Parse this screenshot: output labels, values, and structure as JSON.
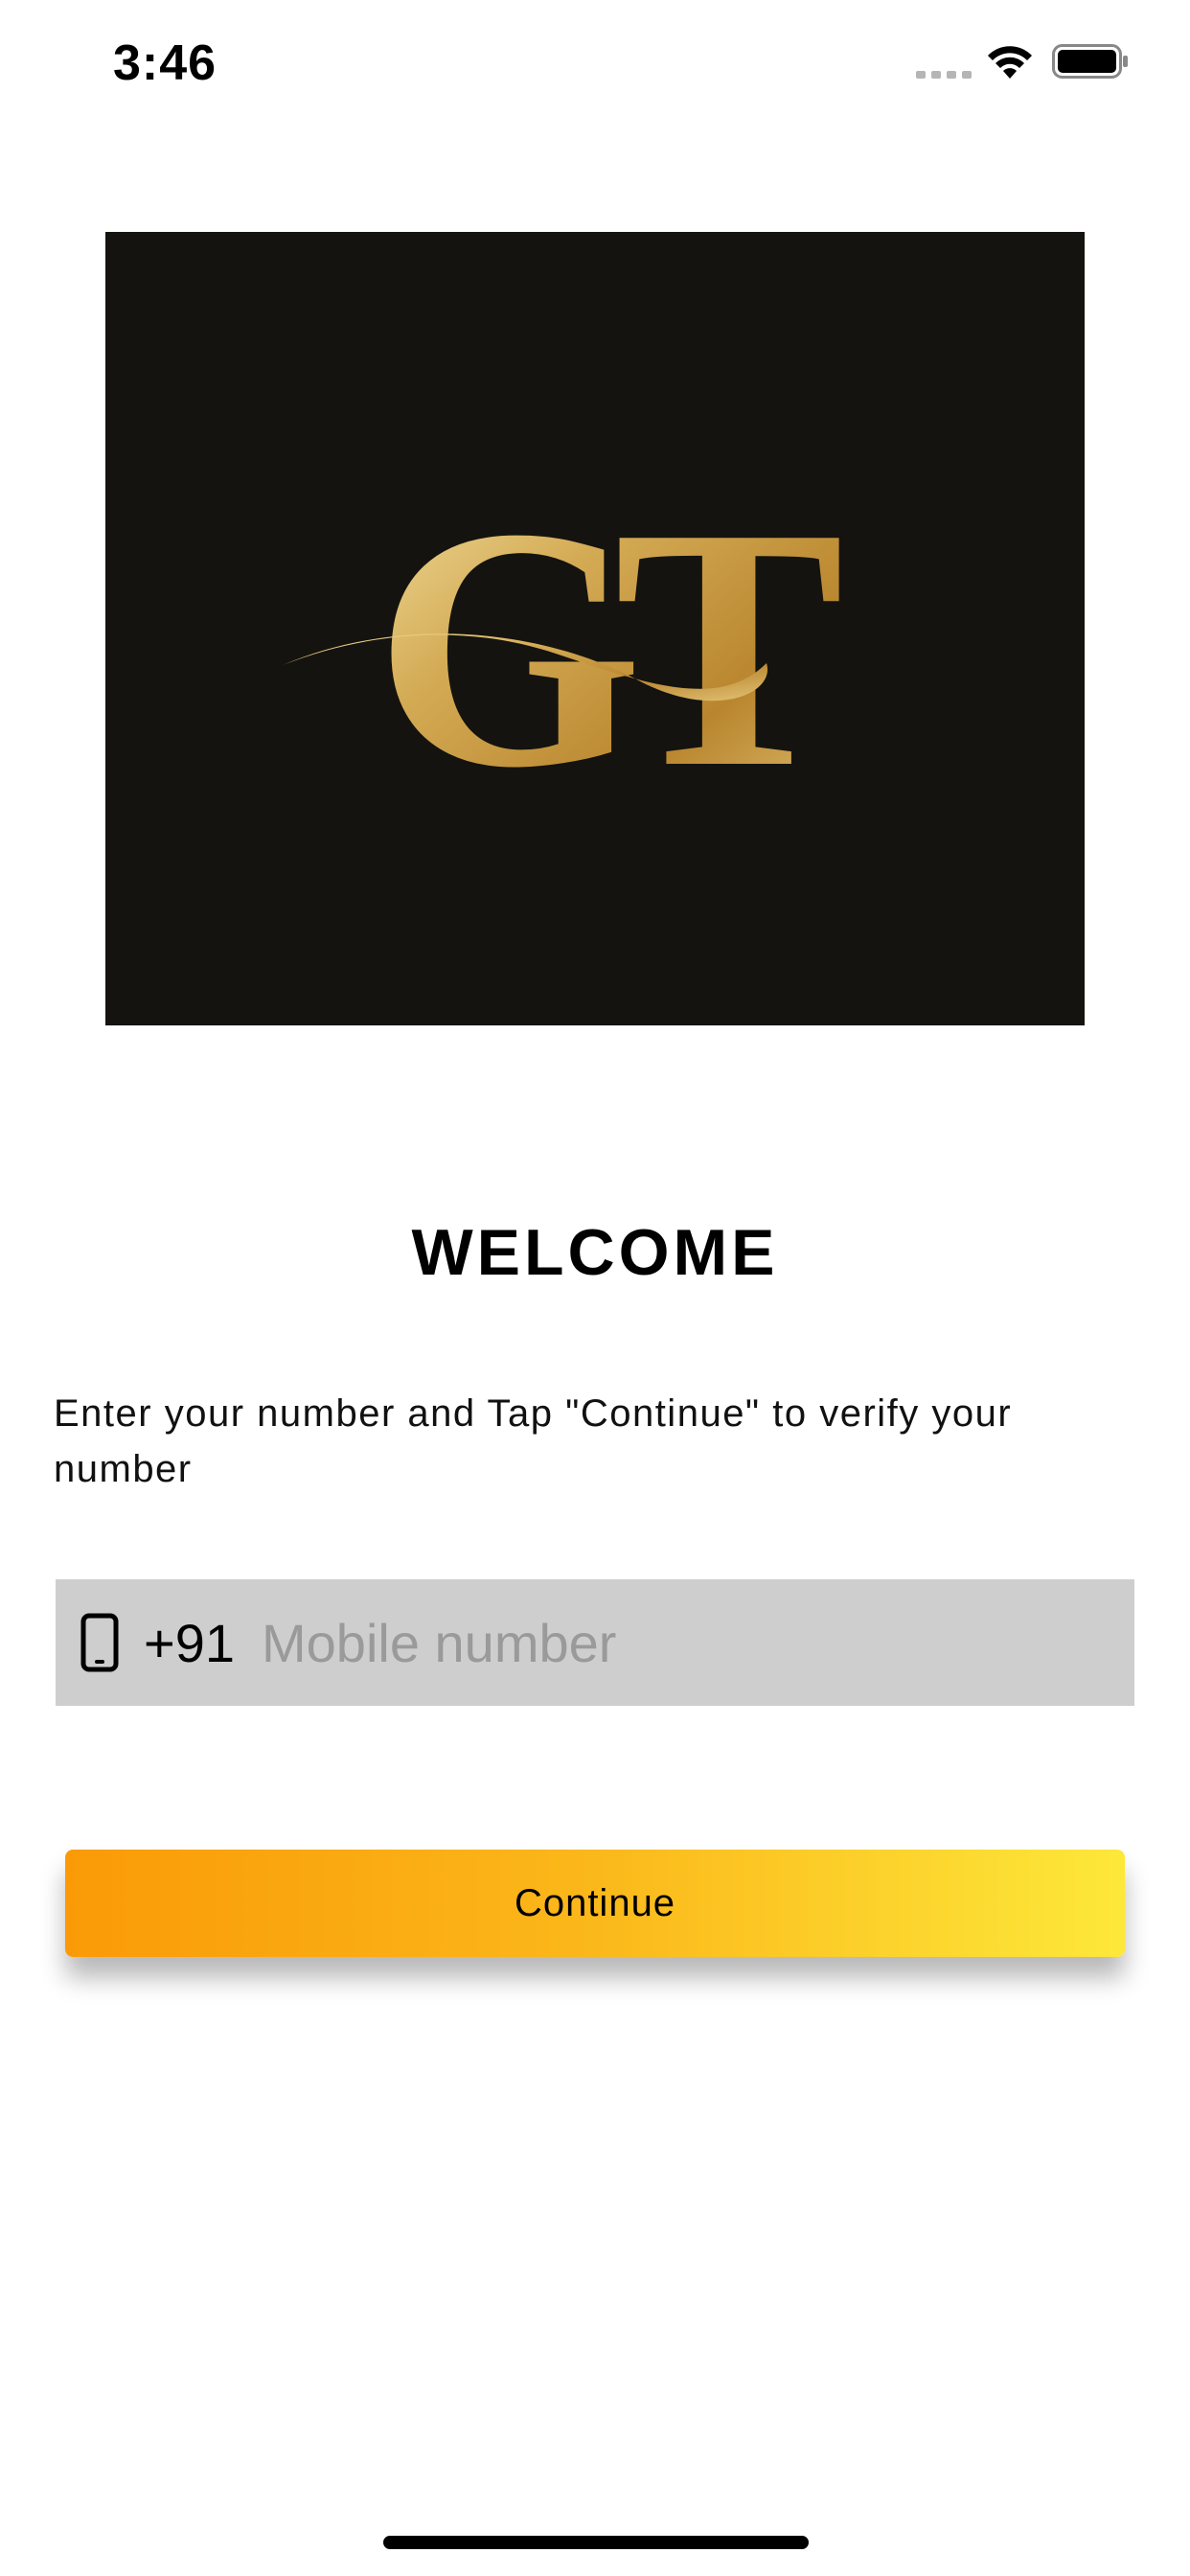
{
  "status_bar": {
    "time": "3:46",
    "icons": [
      "signal-icon",
      "wifi-icon",
      "battery-icon"
    ]
  },
  "logo": {
    "text": "GT",
    "background": "#14130f",
    "color": "#c9a24a"
  },
  "welcome": {
    "title": "WELCOME",
    "instructions": "Enter your number and Tap \"Continue\" to verify your number"
  },
  "phone_input": {
    "icon": "mobile-phone-icon",
    "country_code": "+91",
    "value": "",
    "placeholder": "Mobile number"
  },
  "continue_button": {
    "label": "Continue",
    "gradient_start": "#fa9a07",
    "gradient_end": "#fde83a"
  }
}
